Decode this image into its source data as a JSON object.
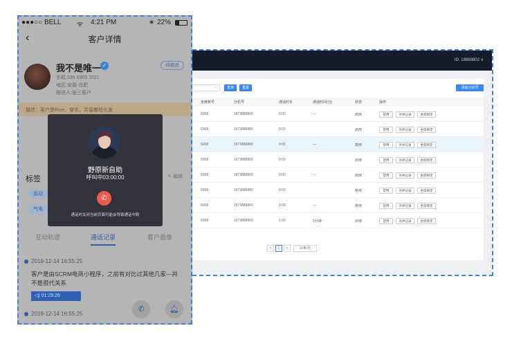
{
  "phone": {
    "status": {
      "carrier": "●●●○○ BELL",
      "wifi": "ᯤ",
      "time": "4:21 PM",
      "battery": "22%"
    },
    "nav": {
      "title": "客户详情"
    },
    "customer": {
      "name": "我不是唯一",
      "edit_label": "待跟进",
      "phone": "手机:135 6969 2021",
      "region": "地区:安徽-合肥",
      "follower": "跟进人:张三客户",
      "remark": "描述：客户是Rice，穿衣，并留着短头发"
    },
    "call_overlay": {
      "name": "野原新自助",
      "timer": "呼叫中03:00:00",
      "note": "通话时关闭当前页面可能会导致通话中断"
    },
    "tags": {
      "title": "标签",
      "edit": "✎ 编辑",
      "chips": [
        "运动",
        "气电"
      ]
    },
    "tabs": [
      "互动轨迹",
      "通话记录",
      "客户画像"
    ],
    "active_tab": 1,
    "timeline": [
      {
        "time": "2019-12-14 16:55:25",
        "text": "客户是由SCRM电商小程序，之前有对比过其他几家—并不是很代关系",
        "audio": "◁) 01:29:26"
      },
      {
        "time": "2019-12-14 16:55:25"
      }
    ]
  },
  "desktop": {
    "user": "ID: 18888802 ∨",
    "filter_placeholder": "全",
    "buttons": {
      "search": "查询",
      "reset": "重置",
      "add": "添加分机号"
    },
    "columns": [
      "坐席账号",
      "分机号",
      "通话时长",
      "通话时间(分)",
      "状态",
      "操作"
    ],
    "rows": [
      {
        "account": "6008",
        "ext": "1873888800",
        "duration": "0:00",
        "minutes": "—",
        "status": "启用"
      },
      {
        "account": "6008",
        "ext": "1673888880",
        "duration": "0:00",
        "minutes": "",
        "status": "启用"
      },
      {
        "account": "6008",
        "ext": "1873888880",
        "duration": "0:00",
        "minutes": "—",
        "status": "禁用"
      },
      {
        "account": "6008",
        "ext": "1673888800",
        "duration": "0:00",
        "minutes": "",
        "status": "启用"
      },
      {
        "account": "6008",
        "ext": "1873888800",
        "duration": "0:00",
        "minutes": "—",
        "status": "启用"
      },
      {
        "account": "6008",
        "ext": "1673888880",
        "duration": "0:00",
        "minutes": "",
        "status": "禁用"
      },
      {
        "account": "6008",
        "ext": "1573888800",
        "duration": "0:00",
        "minutes": "—",
        "status": "禁用"
      },
      {
        "account": "6008",
        "ext": "1673888800",
        "duration": "1:00",
        "minutes": "5分钟",
        "status": "启用"
      }
    ],
    "actions": [
      "禁用",
      "外呼记录",
      "坐席绑定"
    ],
    "highlighted_row": 2,
    "pager": {
      "prev": "<",
      "page": "1",
      "next": ">",
      "goto": "10条/页"
    }
  }
}
